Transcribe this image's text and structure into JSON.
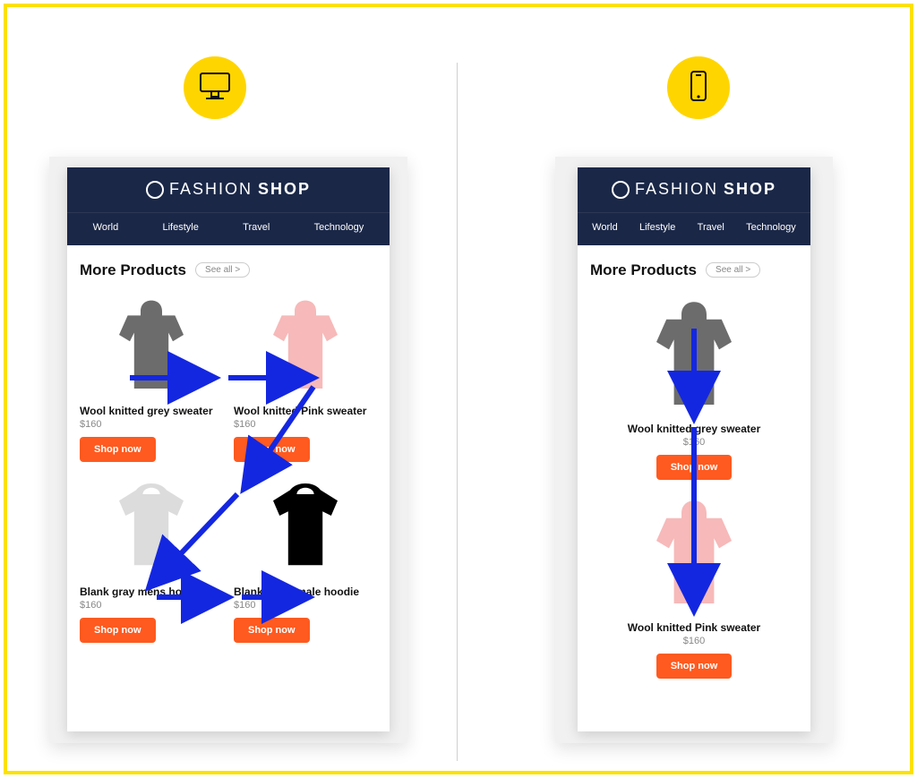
{
  "brand": {
    "thin": "FASHION",
    "bold": "SHOP"
  },
  "nav": [
    "World",
    "Lifestyle",
    "Travel",
    "Technology"
  ],
  "section_title": "More Products",
  "see_all": "See all >",
  "shop_label": "Shop now",
  "arrow_color": "#1427e0",
  "desktop_products": [
    {
      "name": "Wool knitted grey sweater",
      "price": "$160",
      "kind": "sw-grey"
    },
    {
      "name": "Wool knitted Pink sweater",
      "price": "$160",
      "kind": "sw-pink"
    },
    {
      "name": "Blank gray mens hoodie",
      "price": "$160",
      "kind": "hoodie-g"
    },
    {
      "name": "Blank black male hoodie",
      "price": "$160",
      "kind": "hoodie-b"
    }
  ],
  "mobile_products": [
    {
      "name": "Wool knitted grey sweater",
      "price": "$160",
      "kind": "sw-grey"
    },
    {
      "name": "Wool knitted Pink sweater",
      "price": "$160",
      "kind": "sw-pink"
    }
  ]
}
